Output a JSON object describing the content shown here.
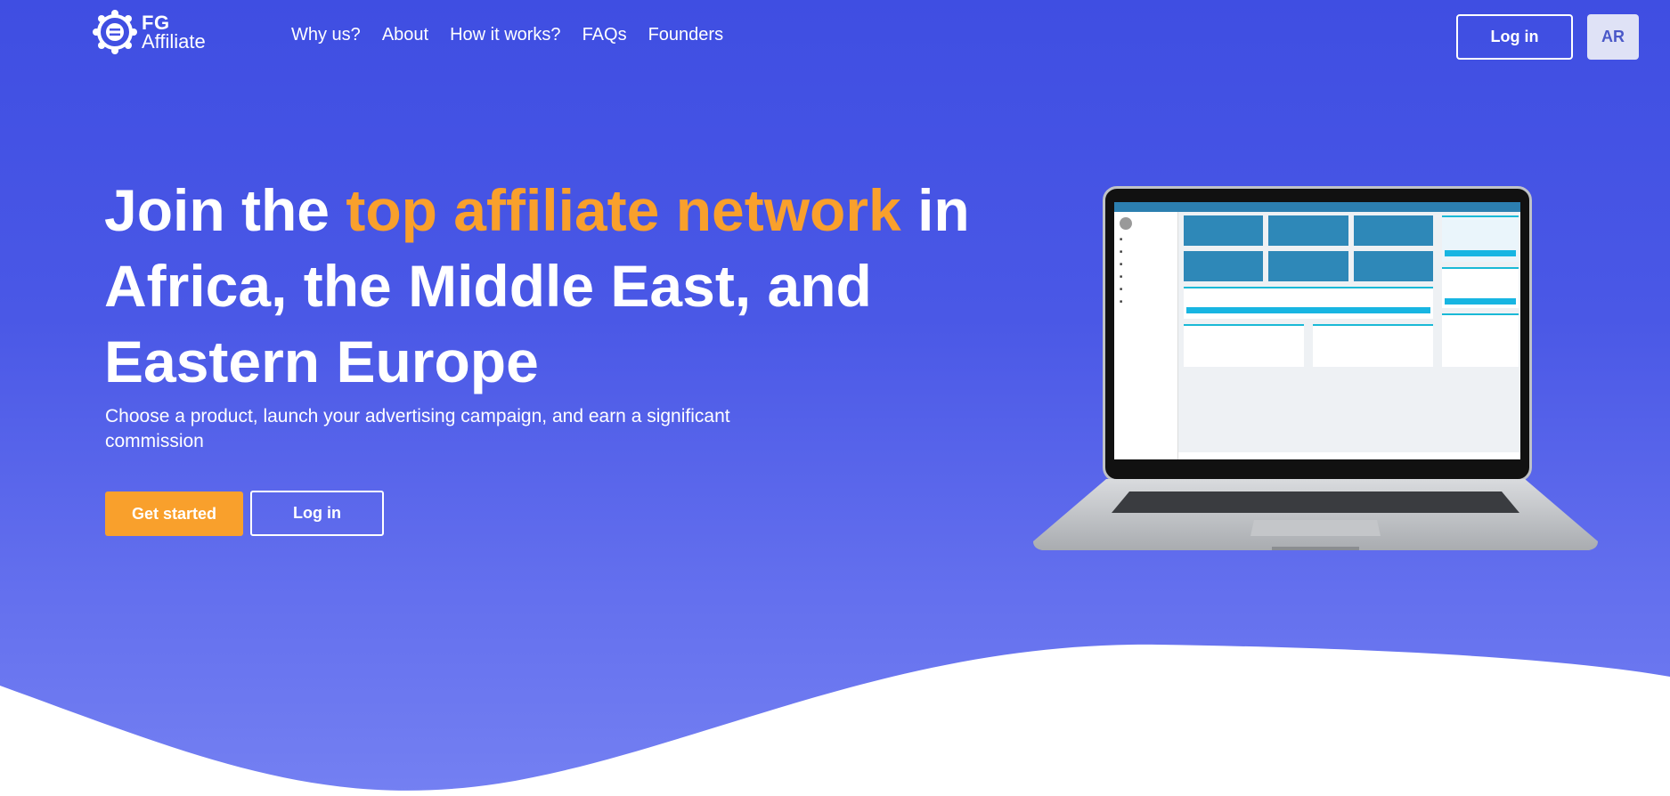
{
  "logo": {
    "line1": "FG",
    "line2": "Affiliate"
  },
  "nav": [
    "Why us?",
    "About",
    "How it works?",
    "FAQs",
    "Founders"
  ],
  "header": {
    "login_label": "Log in",
    "lang_label": "AR"
  },
  "hero": {
    "title_part1": "Join the ",
    "title_accent": "top affiliate network",
    "title_part2": " in Africa, the Middle East, and Eastern Europe",
    "subtitle": "Choose a product, launch your advertising campaign, and earn a significant commission",
    "cta_primary": "Get started",
    "cta_secondary": "Log in"
  },
  "colors": {
    "accent": "#f9a02c",
    "background": "#4552e4",
    "white": "#ffffff"
  }
}
